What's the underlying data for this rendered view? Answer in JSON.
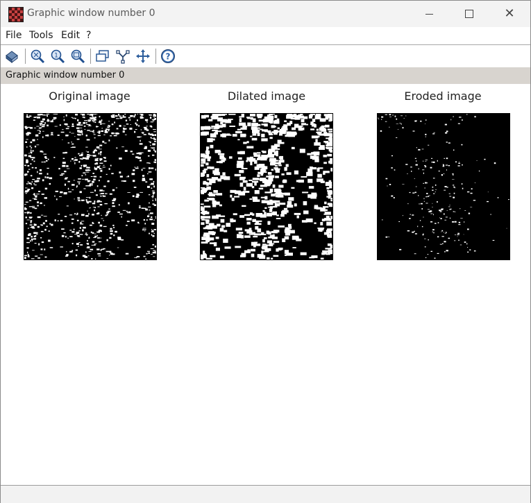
{
  "window": {
    "title": "Graphic window number 0",
    "controls": {
      "minimize": "—",
      "maximize": "☐",
      "close": "✕"
    }
  },
  "menu": {
    "items": [
      "File",
      "Tools",
      "Edit",
      "?"
    ]
  },
  "toolbar": {
    "icons": [
      "rotate-icon",
      "zoom-icon",
      "zoom-original-icon",
      "unzoom-icon",
      "datatip-icon",
      "data-editor-icon",
      "pan-icon",
      "help-icon"
    ]
  },
  "infobar": {
    "label": "Graphic window number 0"
  },
  "figure": {
    "panels": [
      {
        "title": "Original image"
      },
      {
        "title": "Dilated image"
      },
      {
        "title": "Eroded image"
      }
    ]
  },
  "colors": {
    "infobar_bg": "#d8d4cf",
    "image_bg": "#000000",
    "image_fg": "#ffffff"
  }
}
